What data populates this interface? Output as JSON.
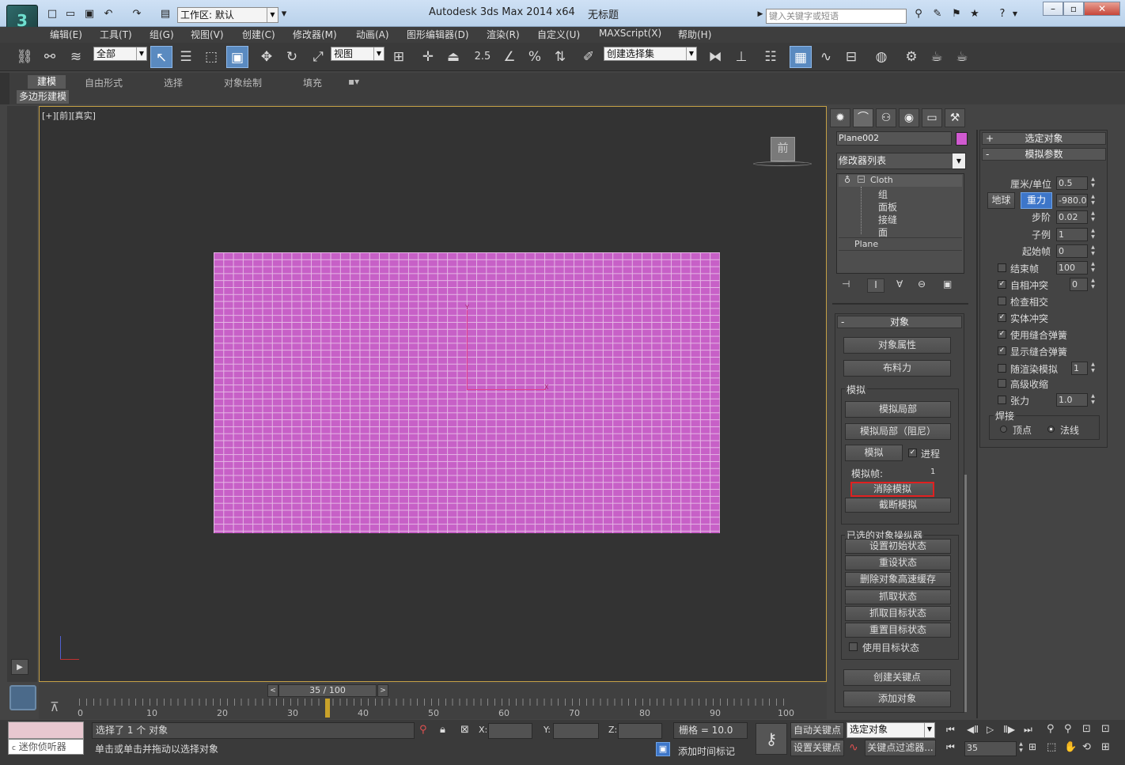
{
  "app": {
    "title": "Autodesk 3ds Max  2014 x64",
    "doc_title": "无标题",
    "logo_text": "3",
    "workspace_value": "工作区: 默认",
    "search_placeholder": "键入关键字或短语"
  },
  "menu": [
    "编辑(E)",
    "工具(T)",
    "组(G)",
    "视图(V)",
    "创建(C)",
    "修改器(M)",
    "动画(A)",
    "图形编辑器(D)",
    "渲染(R)",
    "自定义(U)",
    "MAXScript(X)",
    "帮助(H)"
  ],
  "toolbar": {
    "selection_filter": "全部",
    "ref_coord": "视图",
    "named_selection": "创建选择集",
    "snap_label": "2.5"
  },
  "ribbon": {
    "tabs": [
      "建模",
      "自由形式",
      "选择",
      "对象绘制",
      "填充"
    ],
    "sub_tab": "多边形建模"
  },
  "viewport": {
    "label": "[+][前][真实]",
    "viewcube_label": "前"
  },
  "timeline": {
    "frame_display": "35 / 100",
    "ticks": [
      "0",
      "10",
      "20",
      "30",
      "40",
      "50",
      "60",
      "70",
      "80",
      "90",
      "100"
    ]
  },
  "command_panel": {
    "object_name": "Plane002",
    "object_color": "#d05ad0",
    "modifier_list": "修改器列表",
    "stack": {
      "modifier": "Cloth",
      "subs": [
        "组",
        "面板",
        "接缝",
        "面"
      ],
      "base": "Plane"
    },
    "object_rollout": {
      "header": "对象",
      "buttons": [
        "对象属性",
        "布料力"
      ],
      "sim_group": "模拟",
      "sim_local": "模拟局部",
      "sim_local_damped": "模拟局部（阻尼）",
      "simulate": "模拟",
      "progress": "进程",
      "sim_frame_label": "模拟帧:",
      "sim_frame_value": "1",
      "erase_sim": "消除模拟",
      "truncate_sim": "截断模拟",
      "manip_group": "已选的对象操纵器",
      "manip_buttons": [
        "设置初始状态",
        "重设状态",
        "删除对象高速缓存",
        "抓取状态",
        "抓取目标状态",
        "重置目标状态"
      ],
      "use_target": "使用目标状态"
    },
    "params": {
      "header_selected": "选定对象",
      "header_sim": "模拟参数",
      "cm_unit_label": "厘米/单位",
      "cm_unit_value": "0.5",
      "earth": "地球",
      "gravity": "重力",
      "gravity_value": "-980.0",
      "step_label": "步阶",
      "step_value": "0.02",
      "subsample_label": "子例",
      "subsample_value": "1",
      "start_label": "起始帧",
      "start_value": "0",
      "end_label": "结束帧",
      "end_value": "100",
      "self_collision_label": "自相冲突",
      "self_collision_value": "0",
      "check_intersect": "检查相交",
      "solid_collision": "实体冲突",
      "use_sewing": "使用缝合弹簧",
      "show_sewing": "显示缝合弹簧",
      "render_sim": "随渲染模拟",
      "render_sim_value": "1",
      "advanced_pinch": "高级收缩",
      "tension": "张力",
      "tension_value": "1.0",
      "weld_group": "焊接",
      "weld_vertex": "顶点",
      "weld_normal": "法线"
    }
  },
  "status": {
    "selected": "选择了 1 个 对象",
    "prompt": "单击或单击并拖动以选择对象",
    "listener": "迷你侦听器",
    "grid": "栅格 = 10.0",
    "add_time_tag": "添加时间标记",
    "auto_key": "自动关键点",
    "set_key": "设置关键点",
    "key_mode": "选定对象",
    "key_filters": "关键点过滤器...",
    "current_frame": "35",
    "x_label": "X:",
    "y_label": "Y:",
    "z_label": "Z:"
  }
}
